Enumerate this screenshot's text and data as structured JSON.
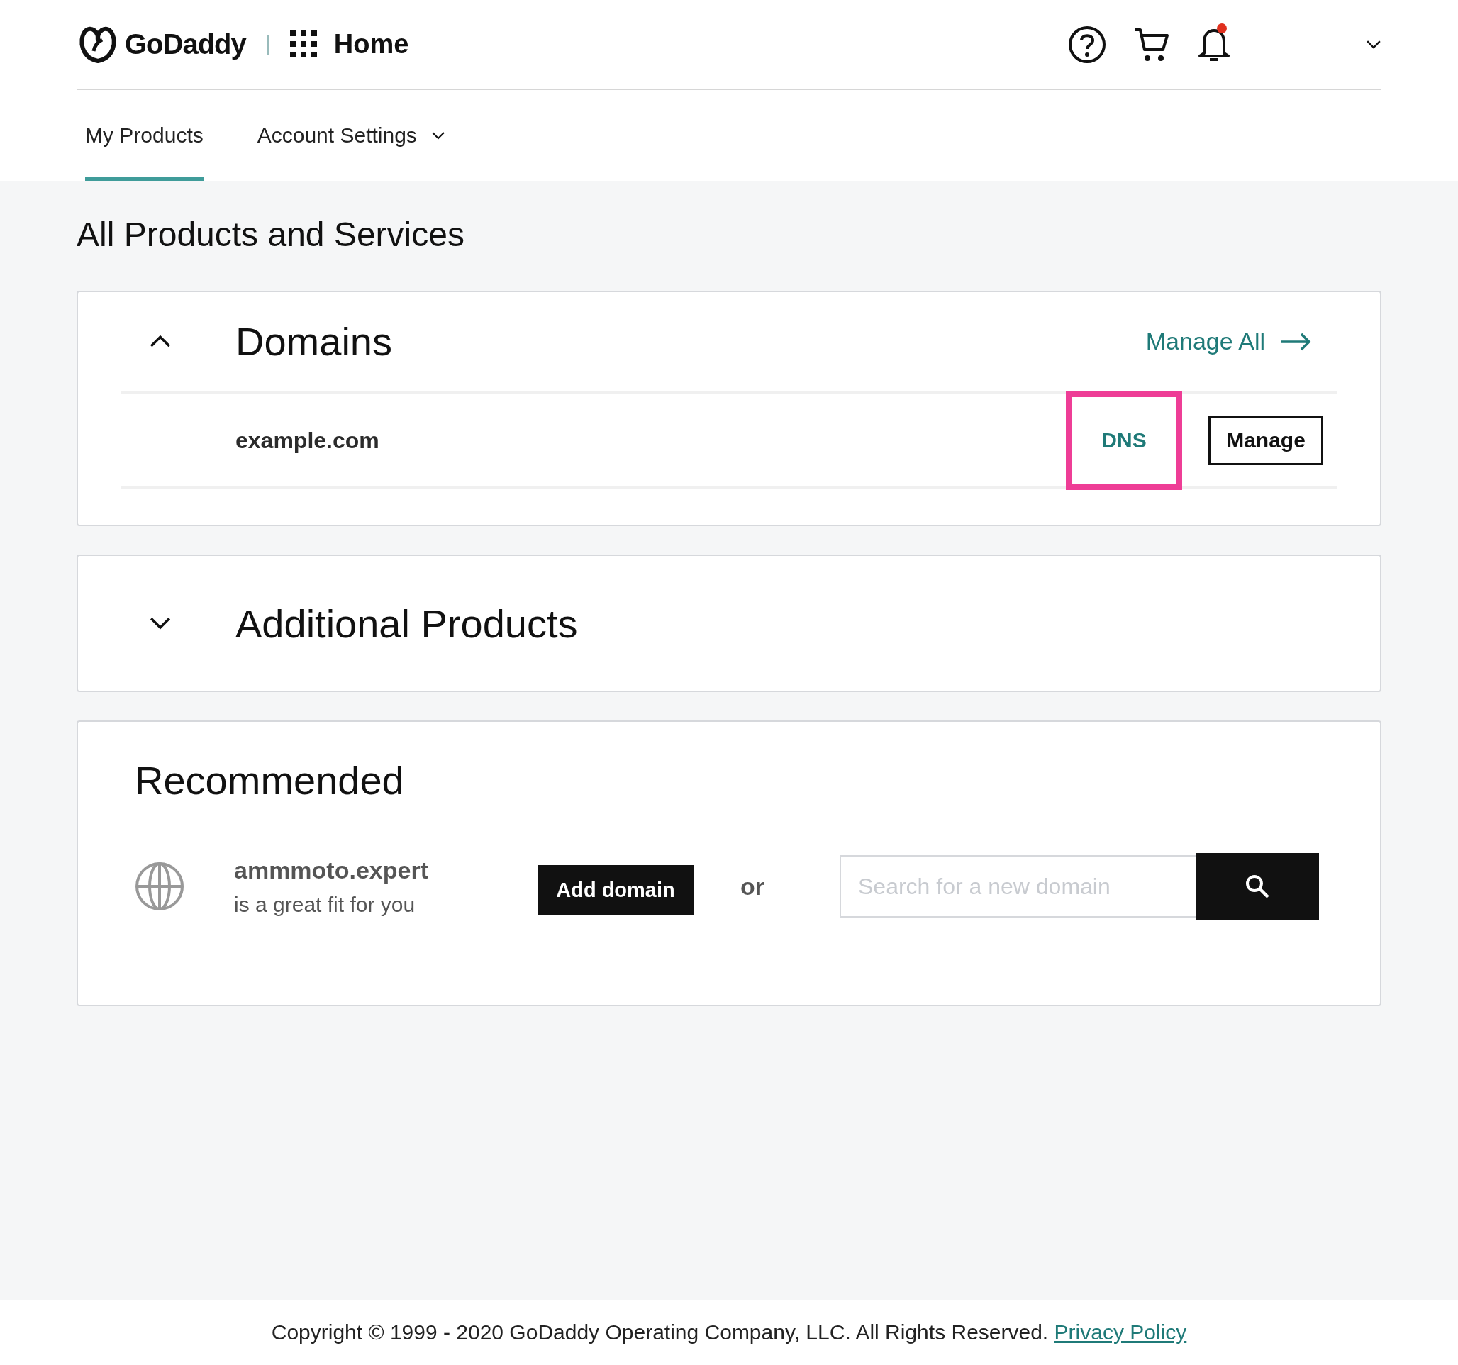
{
  "header": {
    "logo": "GoDaddy",
    "app_menu": "Home",
    "notifications_unread": true
  },
  "tabs": [
    {
      "label": "My Products",
      "selected": true,
      "dropdown": false
    },
    {
      "label": "Account Settings",
      "selected": false,
      "dropdown": true
    }
  ],
  "page_title": "All Products and Services",
  "sections": [
    {
      "title": "Domains",
      "expanded": true,
      "link": "Manage All",
      "rows": [
        {
          "domain": "example.com",
          "actions": [
            {
              "label": "DNS",
              "kind": "link",
              "highlighted": true
            },
            {
              "label": "Manage",
              "kind": "outline",
              "highlighted": false
            }
          ]
        }
      ]
    },
    {
      "title": "Additional Products",
      "expanded": false
    }
  ],
  "recommended": {
    "title": "Recommended",
    "domain": "ammmoto.expert",
    "subtitle": "is a great fit for you",
    "button": "Add domain",
    "separator": "or",
    "search": {
      "placeholder": "Search for a new domain"
    }
  },
  "footer": {
    "copyright": "Copyright © 1999 - 2020 GoDaddy Operating Company, LLC. All Rights Reserved.",
    "link": "Privacy Policy"
  }
}
